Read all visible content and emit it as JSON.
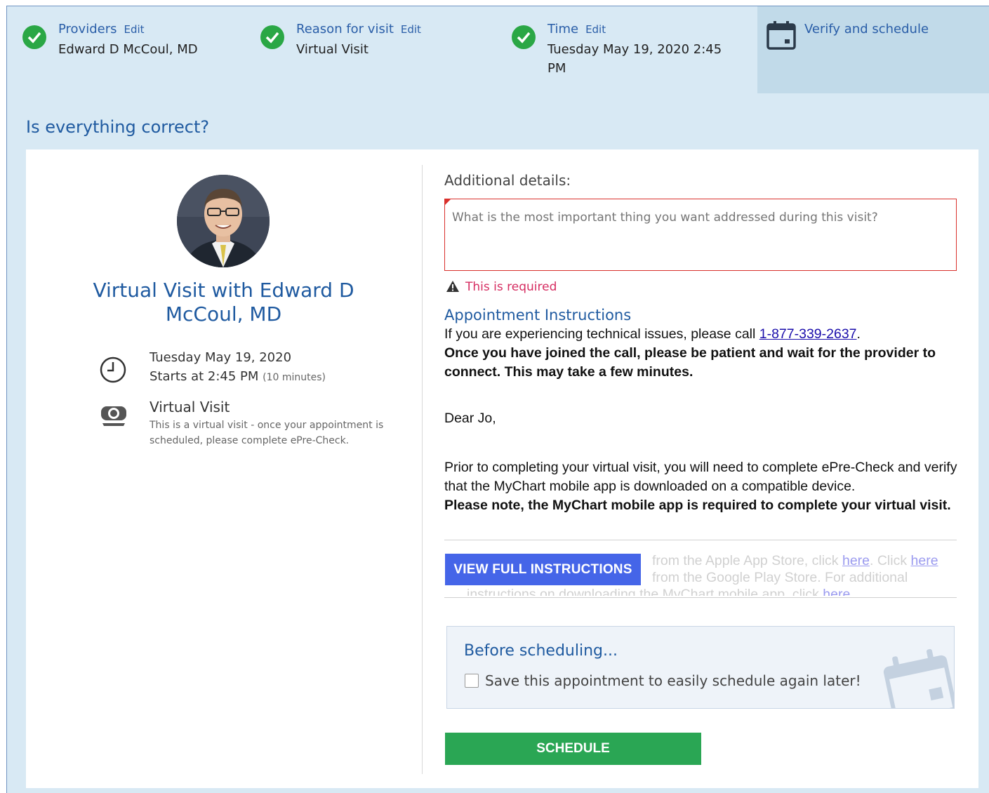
{
  "steps": [
    {
      "title": "Providers",
      "edit": "Edit",
      "value": "Edward D McCoul, MD"
    },
    {
      "title": "Reason for visit",
      "edit": "Edit",
      "value": "Virtual Visit"
    },
    {
      "title": "Time",
      "edit": "Edit",
      "value": "Tuesday May 19, 2020 2:45 PM"
    }
  ],
  "active_step": {
    "title": "Verify and schedule",
    "icon": "calendar-icon"
  },
  "question": "Is everything correct?",
  "summary": {
    "visit_title": "Virtual Visit with Edward D McCoul, MD",
    "date": "Tuesday May 19, 2020",
    "starts": "Starts at 2:45 PM",
    "duration": "(10 minutes)",
    "visit_type": "Virtual Visit",
    "visit_desc": "This is a virtual visit - once your appointment is scheduled, please complete ePre-Check."
  },
  "details": {
    "label": "Additional details:",
    "placeholder": "What is the most important thing you want addressed during this visit?",
    "error": "This is required"
  },
  "instructions": {
    "heading": "Appointment Instructions",
    "tech_text": "If you are experiencing technical issues, please call ",
    "phone": "1-877-339-2637",
    "tech_end": ".",
    "bold1": "Once you have joined the call, please  be patient and wait for the provider to connect. This may take a few minutes.",
    "greeting": "Dear Jo,",
    "para": "Prior to completing your virtual visit, you will need to complete ePre-Check and verify that the MyChart mobile app is downloaded on a compatible device.",
    "bold2": "Please note, the MyChart mobile app is required to complete your virtual visit.",
    "faded1": "from the Apple App Store, click ",
    "faded_link1": "here",
    "faded2": ". Click ",
    "faded_link2": "here",
    "faded3": "from the Google Play Store. For additional",
    "faded4": "instructions on downloading the MyChart mobile app, click ",
    "faded_link3": "here",
    "view_full": "VIEW FULL INSTRUCTIONS"
  },
  "before": {
    "title": "Before scheduling...",
    "checkbox_label": "Save this appointment to easily schedule again later!",
    "checked": false
  },
  "schedule_button": "SCHEDULE",
  "colors": {
    "check": "#2aa745",
    "link": "#2a5ea8",
    "error": "#d62d61",
    "primary": "#4565e8",
    "schedule": "#2aa654"
  }
}
